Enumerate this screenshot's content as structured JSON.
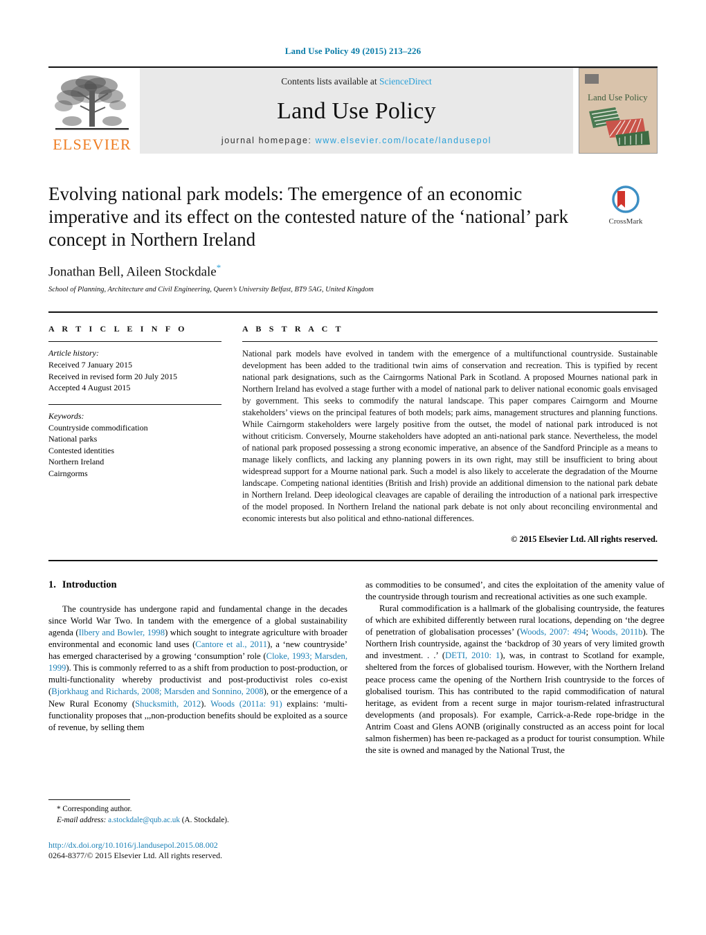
{
  "running_head": "Land Use Policy 49 (2015) 213–226",
  "masthead": {
    "publisher": "ELSEVIER",
    "contents_prefix": "Contents lists available at ",
    "contents_link": "ScienceDirect",
    "journal_title": "Land Use Policy",
    "homepage_prefix": "journal homepage: ",
    "homepage_url": "www.elsevier.com/locate/landusepol",
    "cover_title": "Land Use Policy"
  },
  "article": {
    "title": "Evolving national park models: The emergence of an economic imperative and its effect on the contested nature of the ‘national’ park concept in Northern Ireland",
    "authors": "Jonathan Bell, Aileen Stockdale",
    "corresponding_marker": "*",
    "affiliation": "School of Planning, Architecture and Civil Engineering, Queen’s University Belfast, BT9 5AG, United Kingdom",
    "crossmark_label": "CrossMark"
  },
  "article_info": {
    "heading": "A R T I C L E   I N F O",
    "history_title": "Article history:",
    "history": [
      "Received 7 January 2015",
      "Received in revised form 20 July 2015",
      "Accepted 4 August 2015"
    ],
    "keywords_title": "Keywords:",
    "keywords": [
      "Countryside commodification",
      "National parks",
      "Contested identities",
      "Northern Ireland",
      "Cairngorms"
    ]
  },
  "abstract": {
    "heading": "A B S T R A C T",
    "text": "National park models have evolved in tandem with the emergence of a multifunctional countryside. Sustainable development has been added to the traditional twin aims of conservation and recreation. This is typified by recent national park designations, such as the Cairngorms National Park in Scotland. A proposed Mournes national park in Northern Ireland has evolved a stage further with a model of national park to deliver national economic goals envisaged by government. This seeks to commodify the natural landscape. This paper compares Cairngorm and Mourne stakeholders’ views on the principal features of both models; park aims, management structures and planning functions. While Cairngorm stakeholders were largely positive from the outset, the model of national park introduced is not without criticism. Conversely, Mourne stakeholders have adopted an anti-national park stance. Nevertheless, the model of national park proposed possessing a strong economic imperative, an absence of the Sandford Principle as a means to manage likely conflicts, and lacking any planning powers in its own right, may still be insufficient to bring about widespread support for a Mourne national park. Such a model is also likely to accelerate the degradation of the Mourne landscape. Competing national identities (British and Irish) provide an additional dimension to the national park debate in Northern Ireland. Deep ideological cleavages are capable of derailing the introduction of a national park irrespective of the model proposed. In Northern Ireland the national park debate is not only about reconciling environmental and economic interests but also political and ethno-national differences.",
    "copyright": "© 2015 Elsevier Ltd. All rights reserved."
  },
  "section": {
    "number": "1.",
    "heading": "Introduction"
  },
  "body": {
    "left_p1_a": "The countryside has undergone rapid and fundamental change in the decades since World War Two. In tandem with the emergence of a global sustainability agenda (",
    "left_cite1": "Ilbery and Bowler, 1998",
    "left_p1_b": ") which sought to integrate agriculture with broader environmental and economic land uses (",
    "left_cite2": "Cantore et al., 2011",
    "left_p1_c": "), a ‘new countryside’ has emerged characterised by a growing ‘consumption’ role (",
    "left_cite3": "Cloke, 1993; Marsden, 1999",
    "left_p1_d": "). This is commonly referred to as a shift from production to post-production, or multi-functionality whereby productivist and post-productivist roles co-exist (",
    "left_cite4": "Bjorkhaug and Richards, 2008; Marsden and Sonnino, 2008",
    "left_p1_e": "), or the emergence of a New Rural Economy (",
    "left_cite5": "Shucksmith, 2012",
    "left_p1_f": "). ",
    "left_cite6": "Woods (2011a: 91)",
    "left_p1_g": " explains: ‘multi-functionality proposes that ,,,non-production benefits should be exploited as a source of revenue, by selling them",
    "right_p1_cont": "as commodities to be consumed’, and cites the exploitation of the amenity value of the countryside through tourism and recreational activities as one such example.",
    "right_p2_a": "Rural commodification is a hallmark of the globalising countryside, the features of which are exhibited differently between rural locations, depending on ‘the degree of penetration of globalisation processes’ (",
    "right_cite1": "Woods, 2007: 494",
    "right_p2_b": "; ",
    "right_cite2": "Woods, 2011b",
    "right_p2_c": "). The Northern Irish countryside, against the ‘backdrop of 30 years of very limited growth and investment. . .’ (",
    "right_cite3": "DETI, 2010: 1",
    "right_p2_d": "), was, in contrast to Scotland for example, sheltered from the forces of globalised tourism. However, with the Northern Ireland peace process came the opening of the Northern Irish countryside to the forces of globalised tourism. This has contributed to the rapid commodification of natural heritage, as evident from a recent surge in major tourism-related infrastructural developments (and proposals). For example, Carrick-a-Rede rope-bridge in the Antrim Coast and Glens AONB (originally constructed as an access point for local salmon fishermen) has been re-packaged as a product for tourist consumption. While the site is owned and managed by the National Trust, the"
  },
  "footnotes": {
    "corresponding": "* Corresponding author.",
    "email_label": "E-mail address:",
    "email": "a.stockdale@qub.ac.uk",
    "email_suffix": "(A. Stockdale)."
  },
  "footer": {
    "doi": "http://dx.doi.org/10.1016/j.landusepol.2015.08.002",
    "issn_line": "0264-8377/© 2015 Elsevier Ltd. All rights reserved."
  },
  "colors": {
    "link": "#1a7fb5",
    "accent_blue": "#2aa0d8",
    "elsevier_orange": "#ef7d23",
    "running_head": "#0b7ca8"
  }
}
